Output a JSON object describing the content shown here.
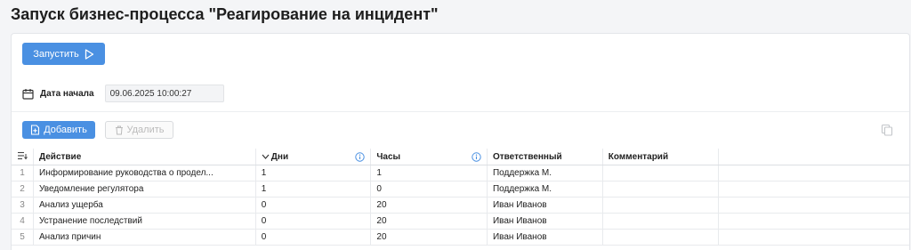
{
  "page": {
    "title": "Запуск бизнес-процесса \"Реагирование на инцидент\""
  },
  "toolbar": {
    "run_label": "Запустить",
    "add_label": "Добавить",
    "delete_label": "Удалить"
  },
  "date": {
    "label": "Дата начала",
    "value": "09.06.2025 10:00:27"
  },
  "table": {
    "columns": {
      "action": "Действие",
      "days": "Дни",
      "hours": "Часы",
      "responsible": "Ответственный",
      "comment": "Комментарий"
    },
    "rows": [
      {
        "n": "1",
        "action": "Информирование руководства о продел...",
        "days": "1",
        "hours": "1",
        "responsible": "Поддержка М.",
        "comment": ""
      },
      {
        "n": "2",
        "action": "Уведомление регулятора",
        "days": "1",
        "hours": "0",
        "responsible": "Поддержка М.",
        "comment": ""
      },
      {
        "n": "3",
        "action": "Анализ ущерба",
        "days": "0",
        "hours": "20",
        "responsible": "Иван Иванов",
        "comment": ""
      },
      {
        "n": "4",
        "action": "Устранение последствий",
        "days": "0",
        "hours": "20",
        "responsible": "Иван Иванов",
        "comment": ""
      },
      {
        "n": "5",
        "action": "Анализ причин",
        "days": "0",
        "hours": "20",
        "responsible": "Иван Иванов",
        "comment": ""
      }
    ]
  },
  "colors": {
    "accent": "#4a90e2",
    "info_icon": "#4a90e2"
  }
}
